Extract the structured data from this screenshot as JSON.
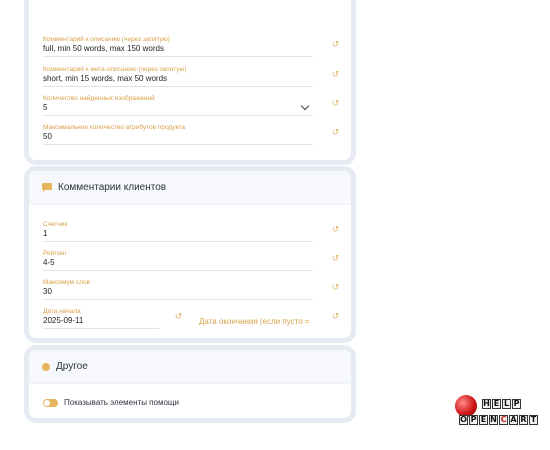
{
  "seo_section": {
    "fields": [
      {
        "label": "Комментарий к описанию (через запятую)",
        "value": "full, min 50 words, max 150 words"
      },
      {
        "label": "Комментарий к мета-описанию (через запятую)",
        "value": "short, min 15 words, max 50 words"
      },
      {
        "label": "Количество найденных изображений",
        "value": "5"
      },
      {
        "label": "Максимальное количество атрибутов продукта",
        "value": "50"
      }
    ]
  },
  "reviews_section": {
    "title": "Комментарии клиентов",
    "fields": [
      {
        "label": "Счетчик",
        "value": "1"
      },
      {
        "label": "Рейтинг",
        "value": "4-5"
      },
      {
        "label": "Максимум слов",
        "value": "30"
      },
      {
        "label": "Дата начала",
        "value": "2025-09-11"
      }
    ],
    "end_date_label": "Дата окончания (если пусто ="
  },
  "other_section": {
    "title": "Другое",
    "toggle_label": "Показывать элементы помощи",
    "toggle_on": true
  },
  "logo": {
    "line1": [
      "H",
      "E",
      "L",
      "P"
    ],
    "line2": [
      "O",
      "P",
      "E",
      "N",
      "C",
      "A",
      "R",
      "T"
    ]
  },
  "icons": {
    "reset": "reset-icon",
    "chevron": "chevron-down-icon",
    "reviews": "chat-icon",
    "other": "dot-icon"
  },
  "colors": {
    "accent": "#e4b55c",
    "label": "#d8a24b",
    "card_border": "#e6ebf3"
  }
}
